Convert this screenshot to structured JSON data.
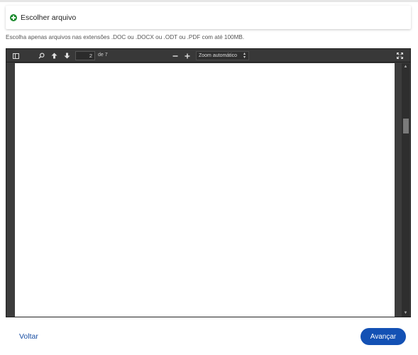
{
  "upload": {
    "choose_file_label": "Escolher arquivo",
    "help_text": "Escolha apenas arquivos nas extensões .DOC ou .DOCX ou .ODT ou .PDF com até 100MB."
  },
  "viewer": {
    "current_page": "2",
    "page_count_label": "de 7",
    "zoom_value": "Zoom automático",
    "icons": [
      "sidebar-toggle-icon",
      "search-icon",
      "arrow-up-icon",
      "arrow-down-icon",
      "zoom-out-icon",
      "zoom-in-icon",
      "fullscreen-icon"
    ]
  },
  "navigation": {
    "back_label": "Voltar",
    "next_label": "Avançar"
  },
  "colors": {
    "accent": "#1351b4",
    "add_icon": "#1b8a2e",
    "viewer_toolbar": "#383838"
  }
}
